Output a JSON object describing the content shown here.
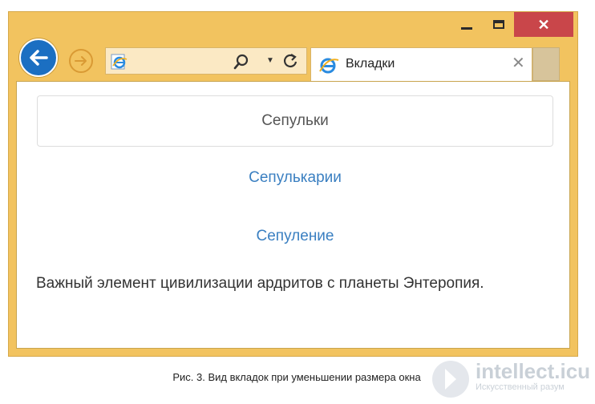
{
  "window": {
    "minimize_icon": "minimize-icon",
    "maximize_icon": "maximize-icon",
    "close_icon": "close-icon",
    "close_color": "#c9464a",
    "frame_color": "#f2c35f"
  },
  "toolbar": {
    "back_icon": "back-arrow-icon",
    "forward_icon": "forward-arrow-icon",
    "address_value": "",
    "search_icon": "search-icon",
    "refresh_icon": "refresh-icon"
  },
  "tab": {
    "label": "Вкладки",
    "close_glyph": "✕"
  },
  "page": {
    "tabs": [
      {
        "label": "Сепульки",
        "active": true
      },
      {
        "label": "Сепулькарии",
        "active": false
      },
      {
        "label": "Сепуление",
        "active": false
      }
    ],
    "description": "Важный элемент цивилизации ардритов с планеты Энтеропия.",
    "link_color": "#3a7fc1"
  },
  "caption": "Рис. 3. Вид вкладок при уменьшении размера окна",
  "watermark": {
    "title": "intellect.icu",
    "subtitle": "Искусственный разум"
  }
}
